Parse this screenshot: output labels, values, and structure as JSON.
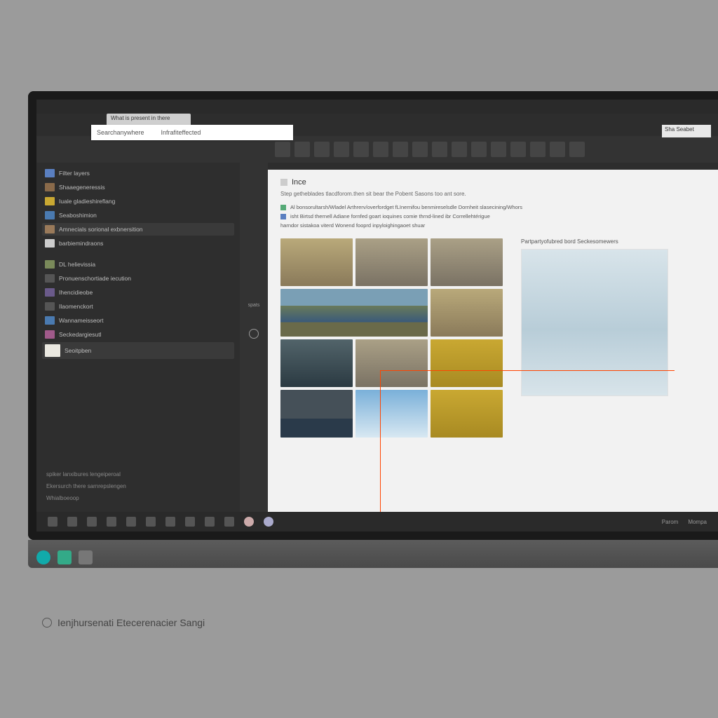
{
  "window": {
    "tab_label": "What is present in there",
    "search_label": "Searchanywhere",
    "search_secondary": "Infrafiteffected",
    "ribbon_right": "Sha Seabet"
  },
  "sidebar": {
    "items": [
      "Filter layers",
      "Shaaegeneressis",
      "Iuale gladieshireflang",
      "Seaboshimion",
      "Amnecials sorional exbnersition",
      "barbiemindraons",
      "DL helievissia",
      "Pronuenschortiade iecution",
      "Ihencidieobe",
      "Ilaomenckort",
      "Wannameisseort",
      "Seckedargiesutl",
      "Seoitpben"
    ],
    "footer_a": "spiker lanxibures lengeiperoal",
    "footer_b": "Ekersurch there sarnrepslengen",
    "footer_c": "Whialboeoop"
  },
  "toolcol": {
    "label_a": "spats"
  },
  "content": {
    "heading": "Ince",
    "description": "Step getheblades tlacdforom.then sit bear the Pobent Sasons too ant sore.",
    "para_1": "Al  bonsorultarsh/Wladel Arthrerv/overfordget fLInernifou benmireselsdle Dornheit slasecining/Whors",
    "para_2": "isht Birtsd thernell Adiane fornfed goart ioquines comie thrnd-lined ibr Correllehtérigue",
    "para_3": "harndor sistakoa viterd Wonend fooprd inpyloighingaoet shuar",
    "preview_title": "Partpartyofubred bord Seckesomewers"
  },
  "status": {
    "btn_a": "Parom",
    "btn_b": "Mompa"
  },
  "caption": "Ienjhursenati Etecerenacier Sangi"
}
